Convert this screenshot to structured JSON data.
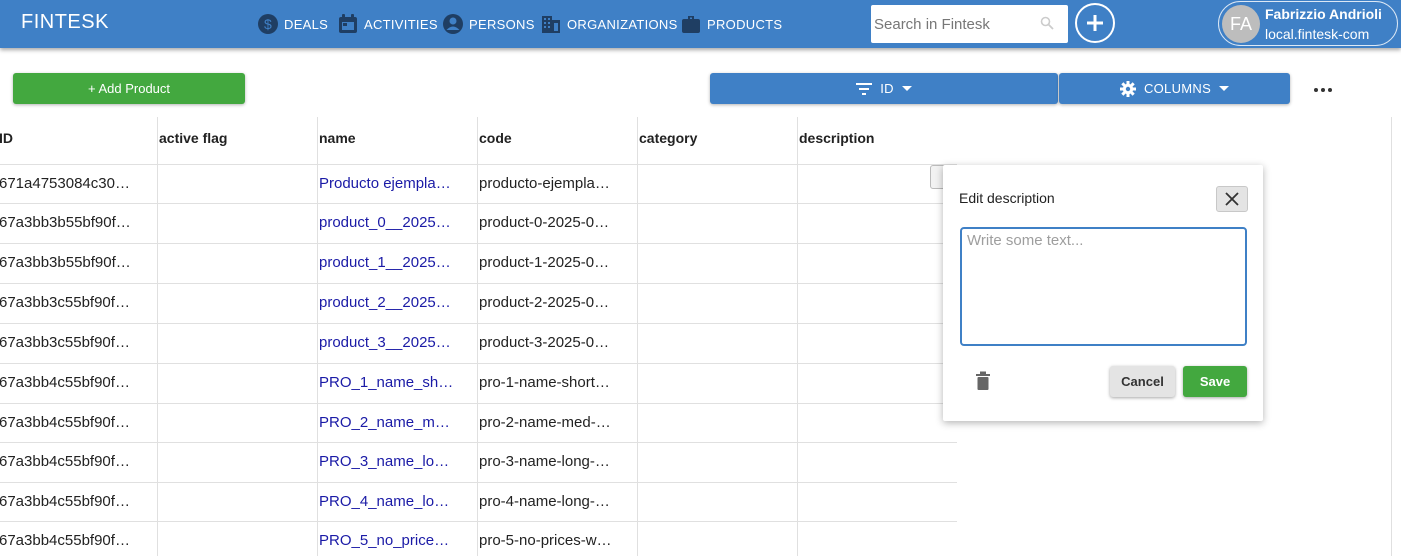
{
  "header": {
    "brand": "FINTESK",
    "nav": [
      {
        "label": "DEALS",
        "icon": "dollar-icon"
      },
      {
        "label": "ACTIVITIES",
        "icon": "calendar-icon"
      },
      {
        "label": "PERSONS",
        "icon": "person-icon"
      },
      {
        "label": "ORGANIZATIONS",
        "icon": "building-icon"
      },
      {
        "label": "PRODUCTS",
        "icon": "briefcase-icon"
      }
    ],
    "search_placeholder": "Search in Fintesk",
    "user": {
      "initials": "FA",
      "name": "Fabrizzio Andrioli",
      "domain": "local.fintesk-com"
    }
  },
  "toolbar": {
    "add_label": "+ Add Product",
    "sort_label": "ID",
    "columns_label": "COLUMNS"
  },
  "table": {
    "columns": [
      "ID",
      "active flag",
      "name",
      "code",
      "category",
      "description"
    ],
    "rows": [
      {
        "id": "671a4753084c30…",
        "active": "",
        "name": "Producto ejempla…",
        "code": "producto-ejempla…",
        "category": "",
        "description": ""
      },
      {
        "id": "67a3bb3b55bf90f…",
        "active": "",
        "name": "product_0__2025…",
        "code": "product-0-2025-0…",
        "category": "",
        "description": ""
      },
      {
        "id": "67a3bb3b55bf90f…",
        "active": "",
        "name": "product_1__2025…",
        "code": "product-1-2025-0…",
        "category": "",
        "description": ""
      },
      {
        "id": "67a3bb3c55bf90f…",
        "active": "",
        "name": "product_2__2025…",
        "code": "product-2-2025-0…",
        "category": "",
        "description": ""
      },
      {
        "id": "67a3bb3c55bf90f…",
        "active": "",
        "name": "product_3__2025…",
        "code": "product-3-2025-0…",
        "category": "",
        "description": ""
      },
      {
        "id": "67a3bb4c55bf90f…",
        "active": "",
        "name": "PRO_1_name_sh…",
        "code": "pro-1-name-short…",
        "category": "",
        "description": ""
      },
      {
        "id": "67a3bb4c55bf90f…",
        "active": "",
        "name": "PRO_2_name_m…",
        "code": "pro-2-name-med-…",
        "category": "",
        "description": ""
      },
      {
        "id": "67a3bb4c55bf90f…",
        "active": "",
        "name": "PRO_3_name_lo…",
        "code": "pro-3-name-long-…",
        "category": "",
        "description": ""
      },
      {
        "id": "67a3bb4c55bf90f…",
        "active": "",
        "name": "PRO_4_name_lo…",
        "code": "pro-4-name-long-…",
        "category": "",
        "description": ""
      },
      {
        "id": "67a3bb4c55bf90f…",
        "active": "",
        "name": "PRO_5_no_price…",
        "code": "pro-5-no-prices-w…",
        "category": "",
        "description": ""
      }
    ]
  },
  "edit_popup": {
    "title": "Edit description",
    "placeholder": "Write some text...",
    "cancel_label": "Cancel",
    "save_label": "Save"
  },
  "colors": {
    "header": "#3f80c6",
    "accent_green": "#43a83f",
    "link": "#1a1aa6"
  }
}
